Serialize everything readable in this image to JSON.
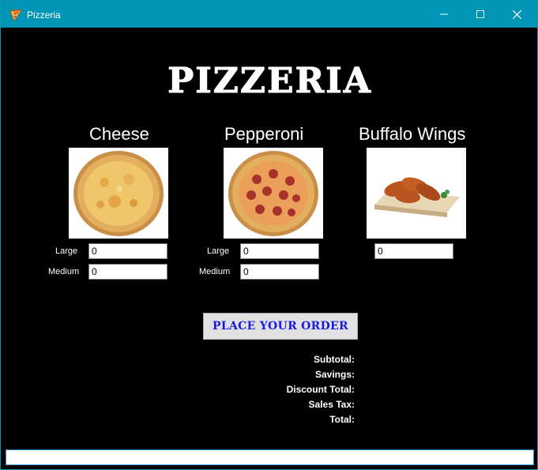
{
  "window": {
    "title": "Pizzeria",
    "icon": "pizza-slice-icon"
  },
  "titlebar_buttons": [
    "minimize-icon",
    "maximize-icon",
    "close-icon"
  ],
  "header": {
    "title": "PIZZERIA"
  },
  "items": [
    {
      "name": "Cheese",
      "image": "cheese-pizza-image",
      "fields": [
        {
          "label": "Large",
          "value": "0"
        },
        {
          "label": "Medium",
          "value": "0"
        }
      ]
    },
    {
      "name": "Pepperoni",
      "image": "pepperoni-pizza-image",
      "fields": [
        {
          "label": "Large",
          "value": "0"
        },
        {
          "label": "Medium",
          "value": "0"
        }
      ]
    },
    {
      "name": "Buffalo Wings",
      "image": "buffalo-wings-image",
      "fields": [
        {
          "label": "",
          "value": "0"
        }
      ]
    }
  ],
  "order_button": {
    "label": "PLACE YOUR ORDER"
  },
  "summary": {
    "subtotal_label": "Subtotal:",
    "savings_label": "Savings:",
    "discount_total_label": "Discount Total:",
    "sales_tax_label": "Sales Tax:",
    "total_label": "Total:"
  },
  "status_input": {
    "value": ""
  },
  "colors": {
    "titlebar": "#0095b6",
    "background": "#000000",
    "order_button_text": "#1a1ae6",
    "pizza_crust": "#d9a45c",
    "pepperoni": "#a8322a"
  }
}
